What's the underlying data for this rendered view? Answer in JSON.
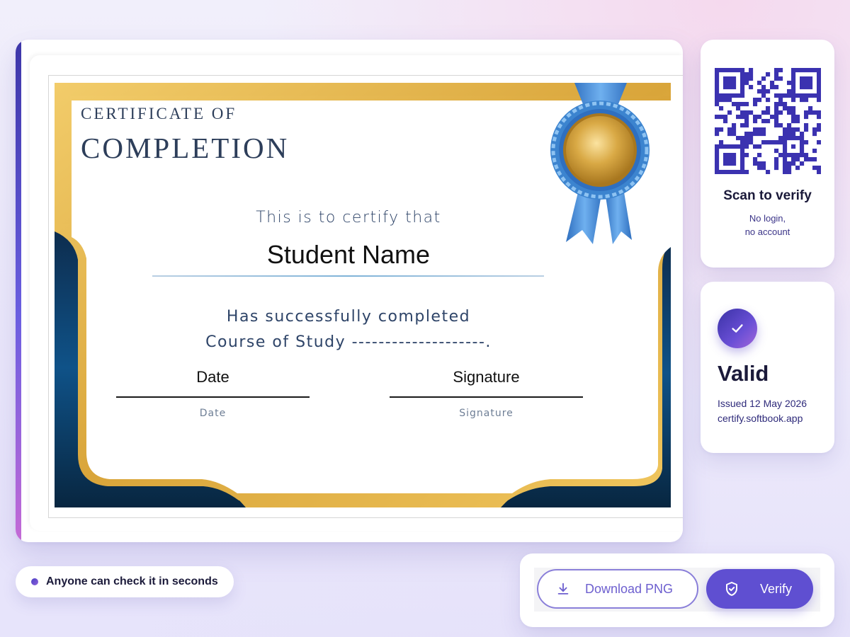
{
  "certificate": {
    "heading_small": "CERTIFICATE OF",
    "heading_big": "COMPLETION",
    "intro": "This is to certify that",
    "recipient": "Student Name",
    "completed": "Has successfully completed",
    "course": "Course of Study --------------------.",
    "date_title": "Date",
    "date_sub": "Date",
    "signature_title": "Signature",
    "signature_sub": "Signature",
    "colors": {
      "gold": "#e6b94f",
      "navy": "#0b3d66",
      "ribbon": "#3c84cf"
    }
  },
  "qr_card": {
    "title": "Scan to verify",
    "sub_line1": "No login,",
    "sub_line2": "no account",
    "qr_color": "#3b32b0"
  },
  "status_card": {
    "status": "Valid",
    "issued": "Issued 12 May 2026",
    "domain": "certify.softbook.app",
    "icon": "check-icon"
  },
  "pill": {
    "text": "Anyone can check it in seconds"
  },
  "actions": {
    "download_label": "Download PNG",
    "download_icon": "download-icon",
    "verify_label": "Verify",
    "verify_icon": "shield-check-icon",
    "accent": "#5f4fd1"
  }
}
